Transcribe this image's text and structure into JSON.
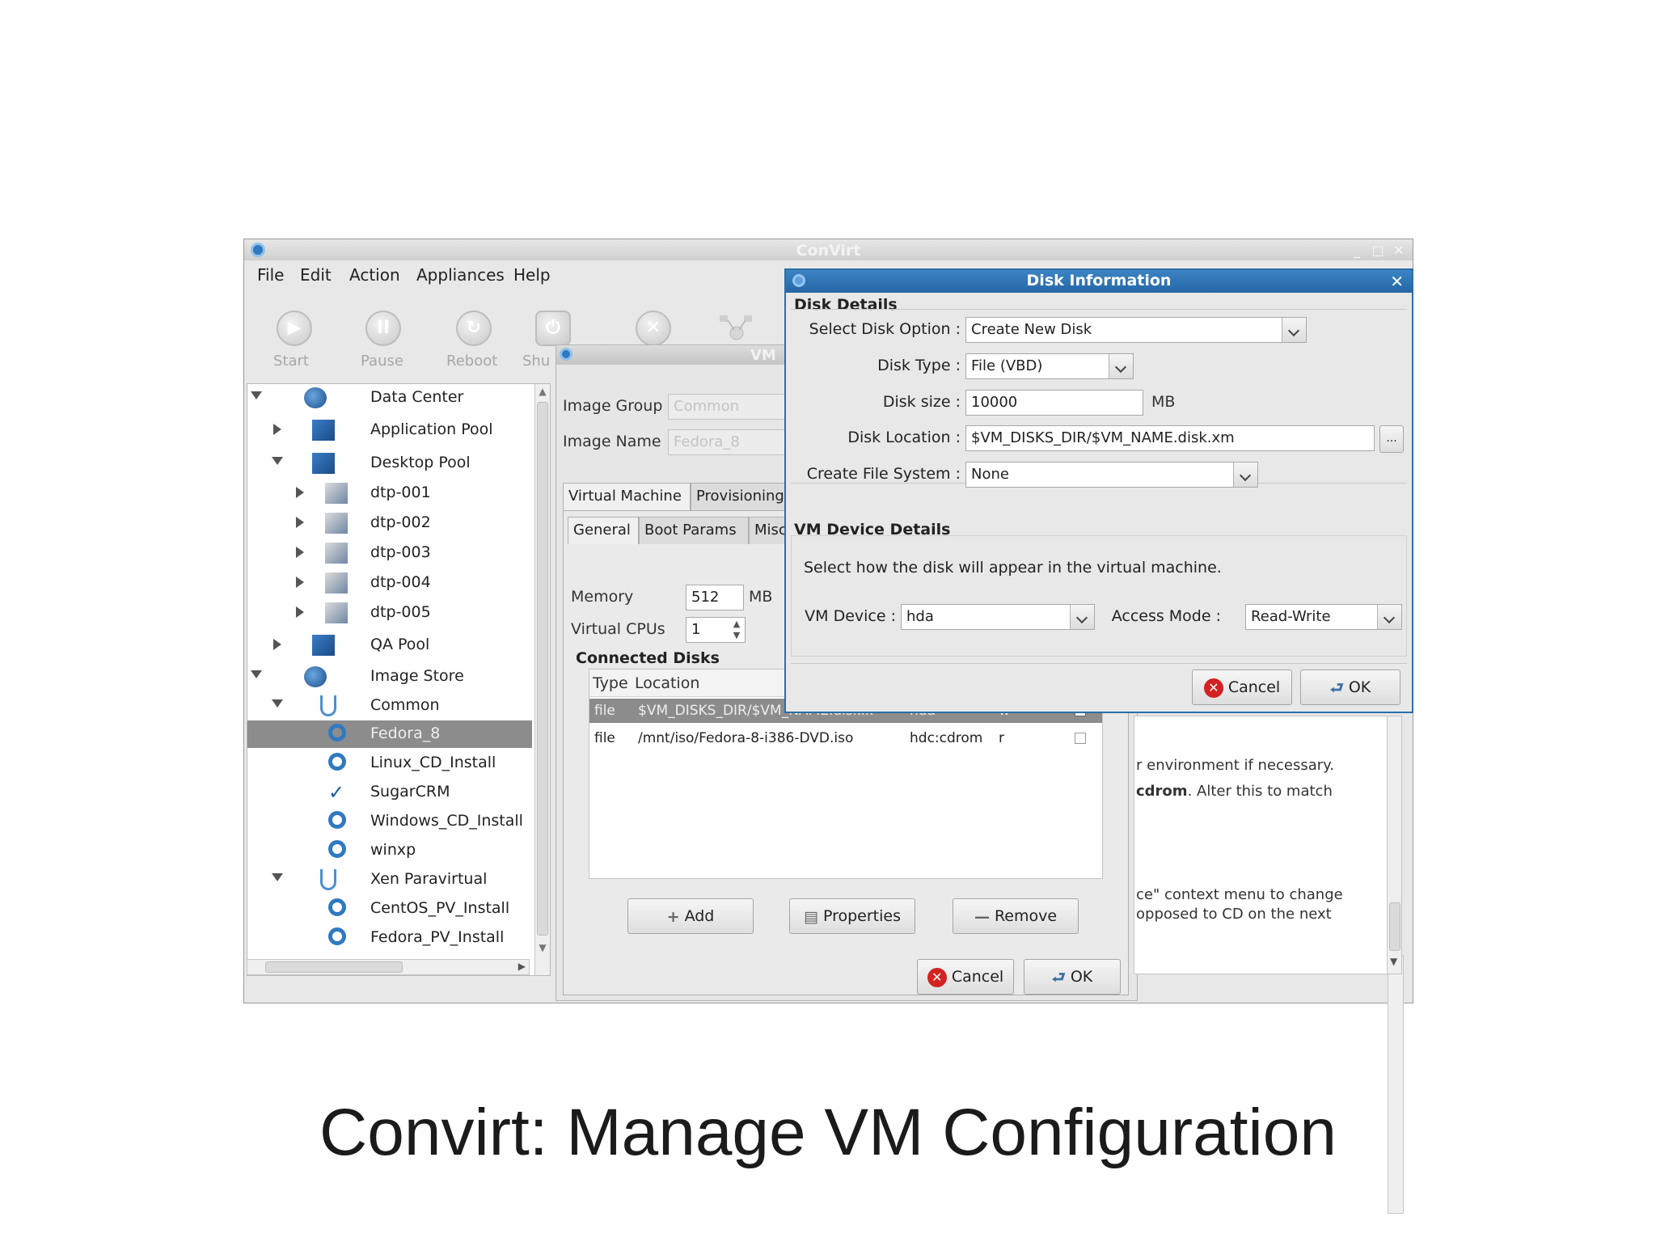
{
  "window": {
    "title": "ConVirt",
    "menu": [
      "File",
      "Edit",
      "Action",
      "Appliances",
      "Help"
    ],
    "toolbar": [
      "Start",
      "Pause",
      "Reboot",
      "Shu"
    ]
  },
  "tree": {
    "items": [
      {
        "label": "Data Center",
        "icon": "globe-icon",
        "expander": "open"
      },
      {
        "label": "Application Pool",
        "icon": "server-pool-icon",
        "expander": "closed"
      },
      {
        "label": "Desktop Pool",
        "icon": "server-pool-icon",
        "expander": "open"
      },
      {
        "label": "dtp-001",
        "icon": "server-icon",
        "expander": "closed"
      },
      {
        "label": "dtp-002",
        "icon": "server-icon",
        "expander": "closed"
      },
      {
        "label": "dtp-003",
        "icon": "server-icon",
        "expander": "closed"
      },
      {
        "label": "dtp-004",
        "icon": "server-icon",
        "expander": "closed"
      },
      {
        "label": "dtp-005",
        "icon": "server-icon",
        "expander": "closed"
      },
      {
        "label": "QA Pool",
        "icon": "server-pool-icon",
        "expander": "closed"
      },
      {
        "label": "Image Store",
        "icon": "globe-icon",
        "expander": "open"
      },
      {
        "label": "Common",
        "icon": "image-group-icon",
        "expander": "open"
      },
      {
        "label": "Fedora_8",
        "icon": "image-icon",
        "expander": "none",
        "selected": true
      },
      {
        "label": "Linux_CD_Install",
        "icon": "image-icon",
        "expander": "none"
      },
      {
        "label": "SugarCRM",
        "icon": "checkmark-icon",
        "expander": "none"
      },
      {
        "label": "Windows_CD_Install",
        "icon": "image-icon",
        "expander": "none"
      },
      {
        "label": "winxp",
        "icon": "image-icon",
        "expander": "none"
      },
      {
        "label": "Xen Paravirtual",
        "icon": "image-group-icon",
        "expander": "open"
      },
      {
        "label": "CentOS_PV_Install",
        "icon": "image-icon",
        "expander": "none"
      },
      {
        "label": "Fedora_PV_Install",
        "icon": "image-icon",
        "expander": "none"
      }
    ]
  },
  "vm": {
    "title": "VM",
    "image_group_label": "Image Group",
    "image_group_value": "Common",
    "image_name_label": "Image Name",
    "image_name_value": "Fedora_8",
    "tabs_top": [
      "Virtual Machine",
      "Provisioning"
    ],
    "tabs_sub": [
      "General",
      "Boot Params",
      "Misc"
    ],
    "memory_label": "Memory",
    "memory_value": "512",
    "memory_unit": "MB",
    "vcpus_label": "Virtual CPUs",
    "vcpus_value": "1",
    "connected_disks_title": "Connected Disks",
    "disk_columns": [
      "Type",
      "Location"
    ],
    "disks": [
      {
        "type": "file",
        "location": "$VM_DISKS_DIR/$VM_NAME.disk.x",
        "device": "hda",
        "mode": "w"
      },
      {
        "type": "file",
        "location": "/mnt/iso/Fedora-8-i386-DVD.iso",
        "device": "hdc:cdrom",
        "mode": "r"
      }
    ],
    "buttons": {
      "add": "Add",
      "properties": "Properties",
      "remove": "Remove",
      "cancel": "Cancel",
      "ok": "OK"
    }
  },
  "dialog": {
    "title": "Disk Information",
    "disk_details": "Disk Details",
    "select_option_label": "Select Disk Option :",
    "select_option_value": "Create New Disk",
    "disk_type_label": "Disk Type :",
    "disk_type_value": "File (VBD)",
    "disk_size_label": "Disk size :",
    "disk_size_value": "10000",
    "disk_size_unit": "MB",
    "disk_location_label": "Disk Location :",
    "disk_location_value": "$VM_DISKS_DIR/$VM_NAME.disk.xm",
    "browse_label": "...",
    "create_fs_label": "Create File System :",
    "create_fs_value": "None",
    "vm_device_details": "VM Device Details",
    "vm_device_hint": "Select how the disk will appear in the virtual machine.",
    "vm_device_label": "VM Device :",
    "vm_device_value": "hda",
    "access_mode_label": "Access Mode :",
    "access_mode_value": "Read-Write",
    "cancel": "Cancel",
    "ok": "OK"
  },
  "info_panel": {
    "lines": [
      "r environment if necessary.",
      "cdrom",
      ". Alter this to match",
      "ce\" context menu to change",
      "opposed to CD on the next"
    ]
  },
  "caption": "Convirt: Manage VM Configuration"
}
